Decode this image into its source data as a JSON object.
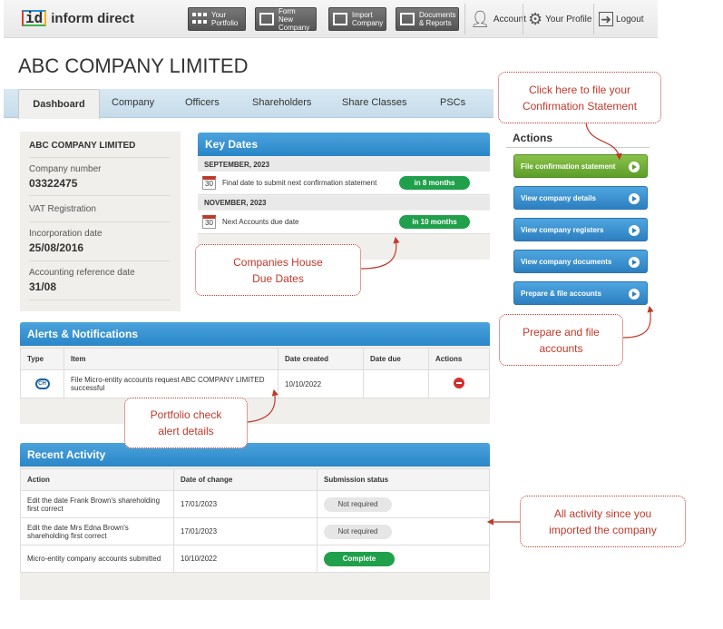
{
  "brand": {
    "logo_mark": "id",
    "logo_text": "inform direct"
  },
  "nav": {
    "portfolio": "Your Portfolio",
    "form_new": "Form New Company",
    "import": "Import Company",
    "documents": "Documents & Reports",
    "account": "Account",
    "profile": "Your Profile",
    "logout": "Logout"
  },
  "company_title": "ABC COMPANY LIMITED",
  "tabs": [
    "Dashboard",
    "Company",
    "Officers",
    "Shareholders",
    "Share Classes",
    "PSCs"
  ],
  "company_card": {
    "name": "ABC COMPANY LIMITED",
    "number_label": "Company number",
    "number": "03322475",
    "vat_label": "VAT Registration",
    "incorp_label": "Incorporation date",
    "incorp": "25/08/2016",
    "ard_label": "Accounting reference date",
    "ard": "31/08"
  },
  "key_dates": {
    "title": "Key Dates",
    "groups": [
      {
        "month": "SEPTEMBER, 2023",
        "day": "30",
        "text": "Final date to submit next confirmation statement",
        "due": "in 8 months"
      },
      {
        "month": "NOVEMBER, 2023",
        "day": "30",
        "text": "Next Accounts due date",
        "due": "in 10 months"
      }
    ]
  },
  "alerts": {
    "title": "Alerts & Notifications",
    "headers": [
      "Type",
      "Item",
      "Date created",
      "Date due",
      "Actions"
    ],
    "rows": [
      {
        "type_icon": "CH",
        "item": "File Micro-entity accounts request ABC COMPANY LIMITED successful",
        "created": "10/10/2022",
        "due": ""
      }
    ]
  },
  "activity": {
    "title": "Recent Activity",
    "headers": [
      "Action",
      "Date of change",
      "Submission status"
    ],
    "rows": [
      {
        "action": "Edit the date Frank Brown's shareholding first correct",
        "date": "17/01/2023",
        "status": "Not required"
      },
      {
        "action": "Edit the date Mrs Edna Brown's shareholding first correct",
        "date": "17/01/2023",
        "status": "Not required"
      },
      {
        "action": "Micro-entity company accounts submitted",
        "date": "10/10/2022",
        "status": "Complete"
      }
    ]
  },
  "actions": {
    "title": "Actions",
    "buttons": [
      "File confirmation statement",
      "View company details",
      "View company registers",
      "View company documents",
      "Prepare & file accounts"
    ]
  },
  "callouts": {
    "confirmation": "Click here to file your Confirmation Statement",
    "due_dates": "Companies House Due Dates",
    "accounts": "Prepare and file accounts",
    "alert": "Portfolio check alert details",
    "activity": "All activity since you imported the company"
  },
  "colors": {
    "accent_blue": "#2a86c8",
    "green": "#20a04b",
    "callout_red": "#c0392b",
    "tab_bg": "#c6dcea"
  }
}
